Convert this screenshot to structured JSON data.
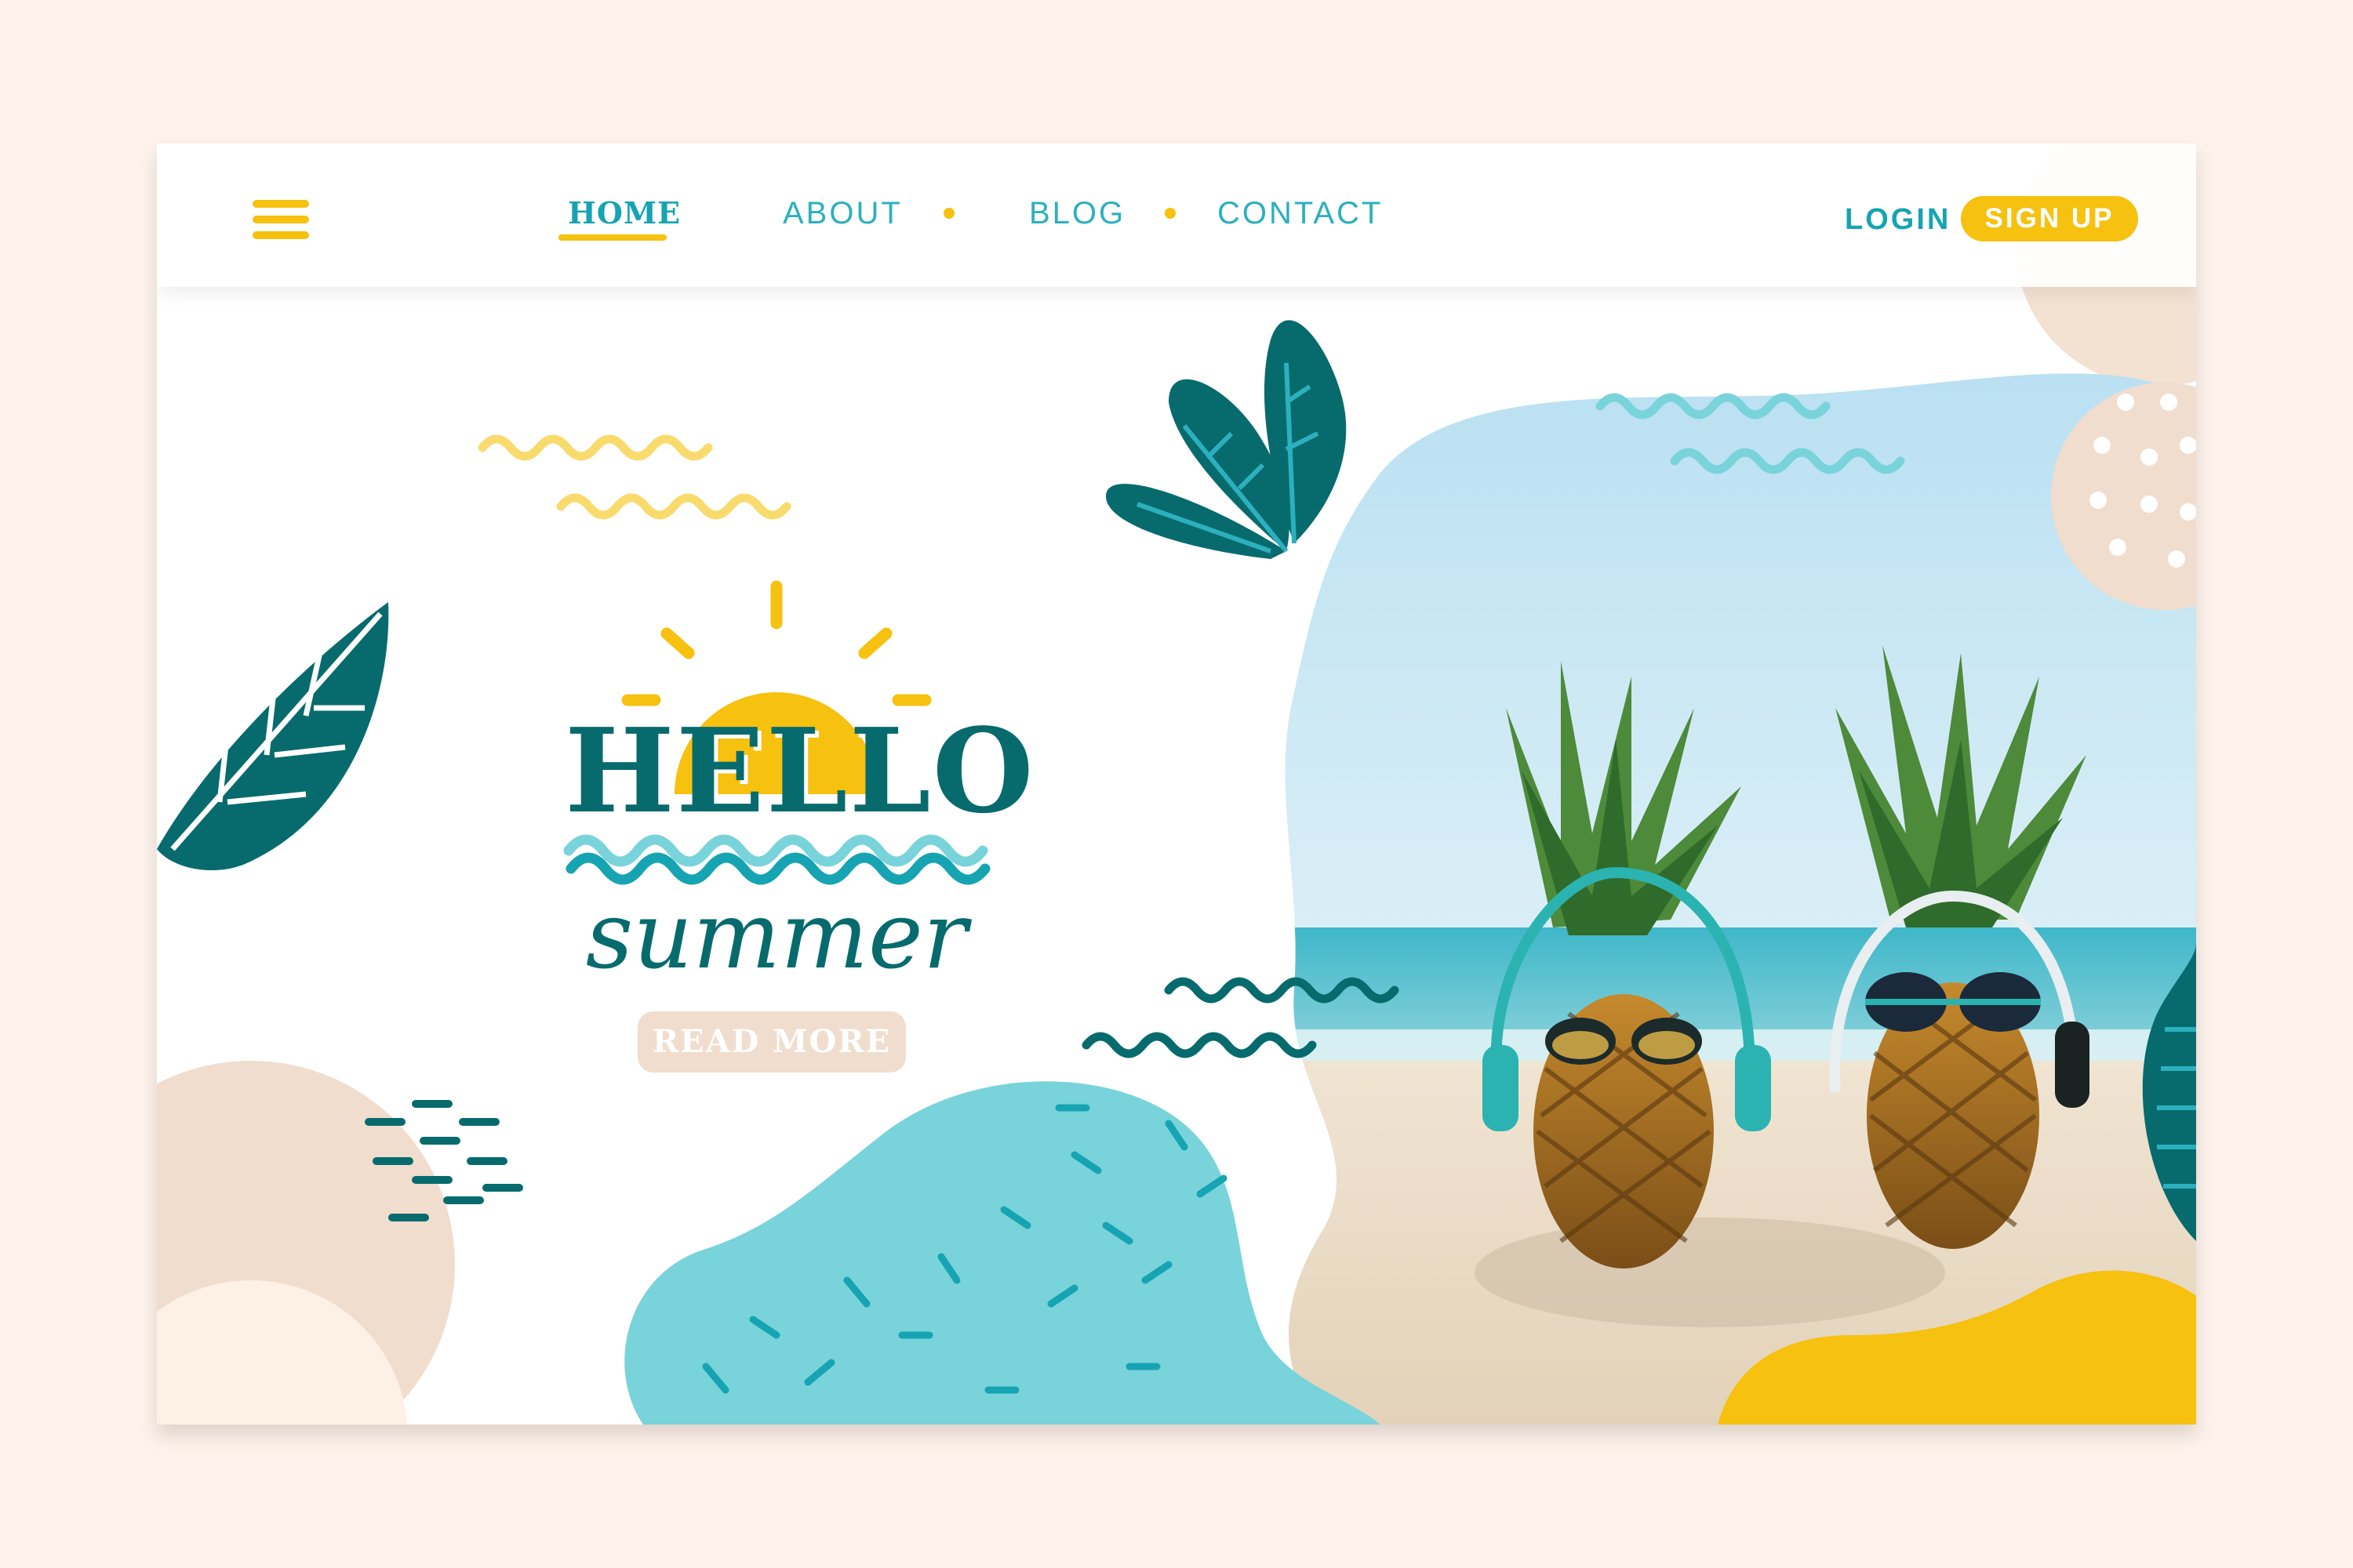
{
  "nav": {
    "home": "HOME",
    "about": "ABOUT",
    "blog": "BLOG",
    "contact": "CONTACT"
  },
  "auth": {
    "login": "LOGIN",
    "signup": "SIGN UP"
  },
  "hero": {
    "title": "HELLO",
    "subtitle": "summer",
    "cta": "READ MORE"
  },
  "colors": {
    "teal_dark": "#076b6e",
    "teal": "#16a4b3",
    "aqua": "#79d3da",
    "yellow": "#f6c10f",
    "sand": "#f1ddcd",
    "background": "#fdf3ec"
  },
  "icons": {
    "menu": "hamburger-menu-icon",
    "sun": "sun-icon",
    "leaf": "leaf-icon"
  },
  "image": {
    "subject": "two pineapples wearing sunglasses and headphones on a beach"
  }
}
